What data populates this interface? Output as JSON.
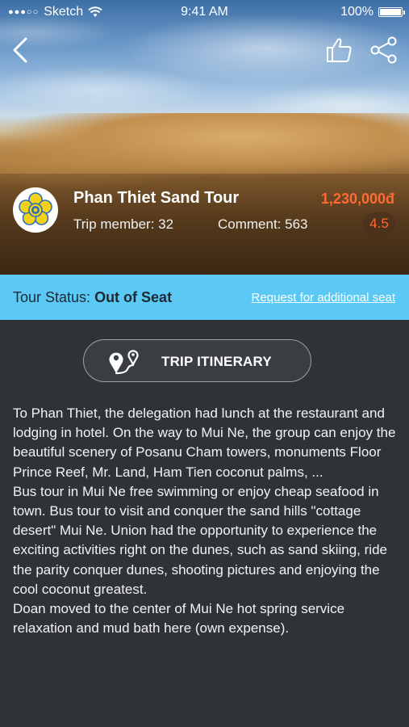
{
  "status_bar": {
    "carrier": "Sketch",
    "time": "9:41 AM",
    "battery": "100%",
    "battery_level": 1.0
  },
  "nav": {
    "back_icon": "chevron-left-icon",
    "like_icon": "thumbs-up-icon",
    "share_icon": "share-icon"
  },
  "tour": {
    "name": "Phan Thiet Sand Tour",
    "price": "1,230,000đ",
    "members": "Trip member: 32",
    "comments": "Comment: 563",
    "rating": "4.5",
    "logo_icon": "flower-logo-icon"
  },
  "status": {
    "label": "Tour Status:",
    "value": "Out of Seat",
    "request_link": "Request for additional seat"
  },
  "itinerary_button": {
    "label": "TRIP ITINERARY",
    "icon": "route-map-pin-icon"
  },
  "description": [
    "To Phan Thiet, the delegation had lunch at the restaurant and lodging in hotel. On the way to Mui Ne, the group can enjoy the beautiful scenery of Posanu Cham towers, monuments Floor Prince Reef, Mr. Land, Ham Tien coconut palms, ...",
    "Bus tour in Mui Ne free swimming or enjoy cheap seafood in town. Bus tour to visit and conquer the sand hills \"cottage desert\" Mui Ne. Union had the opportunity to experience the exciting activities right on the dunes, such as sand skiing, ride the parity conquer dunes, shooting pictures and enjoying the cool coconut greatest.",
    "Doan moved to the center of Mui Ne hot spring service relaxation and mud bath here (own expense)."
  ],
  "colors": {
    "accent_orange": "#ff6a35",
    "status_strip": "#5bc8f5",
    "background": "#2f3338"
  }
}
